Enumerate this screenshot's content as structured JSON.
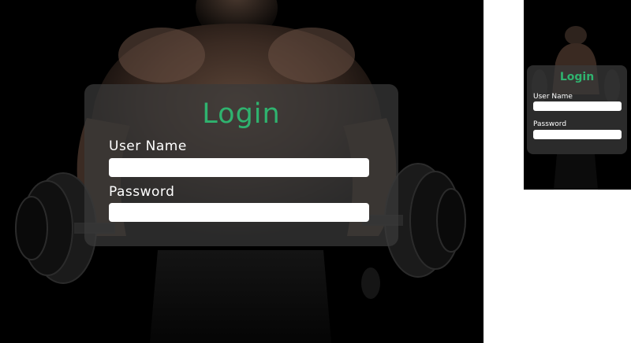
{
  "colors": {
    "accent": "#2fb36f",
    "background": "#000000",
    "card": "#3a3a3a",
    "text": "#ffffff"
  },
  "desktop": {
    "login": {
      "title": "Login",
      "username_label": "User Name",
      "username_value": "",
      "password_label": "Password",
      "password_value": ""
    }
  },
  "mobile": {
    "login": {
      "title": "Login",
      "username_label": "User Name",
      "username_value": "",
      "password_label": "Password",
      "password_value": ""
    }
  }
}
